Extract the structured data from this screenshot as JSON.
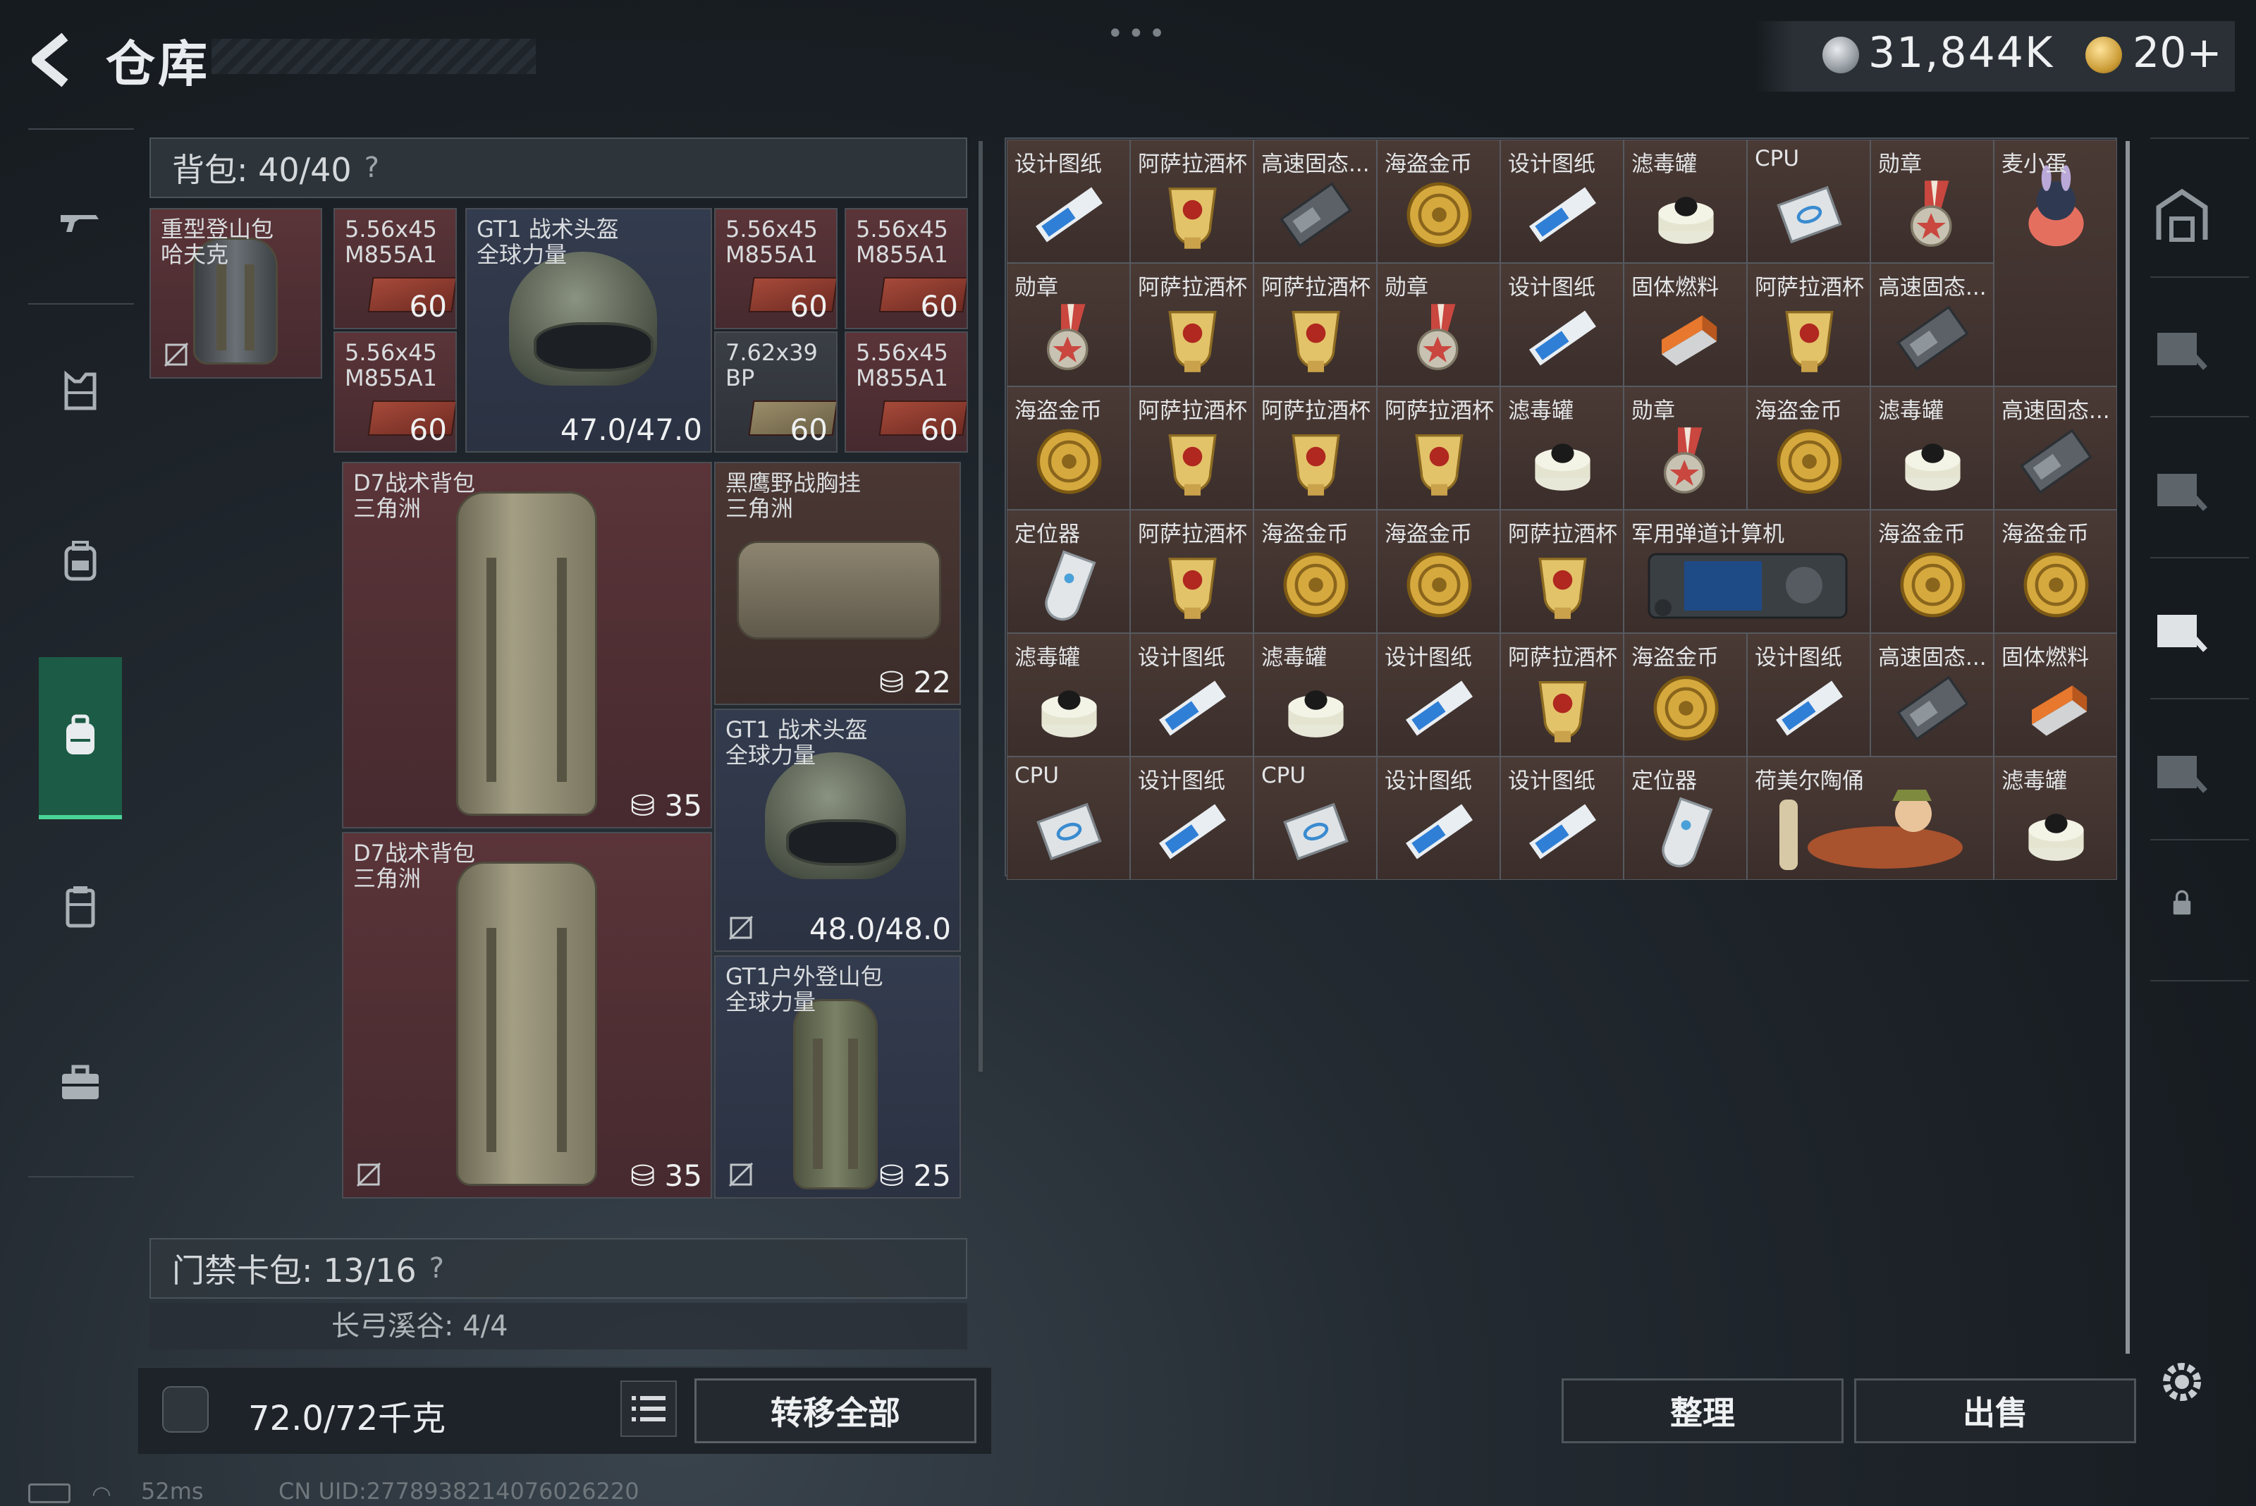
{
  "header": {
    "title": "仓库",
    "currency_value": "31,844K",
    "tickets_value": "20+"
  },
  "backpack": {
    "header_label": "背包: 40/40",
    "help": "?",
    "slots": {
      "hiking_pack": {
        "name": "重型登山包\n哈夫克"
      },
      "ammo1": {
        "name": "5.56x45\nM855A1",
        "qty": "60"
      },
      "ammo2": {
        "name": "5.56x45\nM855A1",
        "qty": "60"
      },
      "ammo3": {
        "name": "5.56x45\nM855A1",
        "qty": "60"
      },
      "ammo4": {
        "name": "5.56x45\nM855A1",
        "qty": "60"
      },
      "ammo5": {
        "name": "7.62x39\nBP",
        "qty": "60"
      },
      "ammo6": {
        "name": "5.56x45\nM855A1",
        "qty": "60"
      },
      "helmet1": {
        "name": "GT1 战术头盔\n全球力量",
        "durability": "47.0/47.0"
      },
      "d7_pack1": {
        "name": "D7战术背包\n三角洲",
        "capacity": "35"
      },
      "d7_pack2": {
        "name": "D7战术背包\n三角洲",
        "capacity": "35"
      },
      "chest_rig": {
        "name": "黑鹰野战胸挂\n三角洲",
        "capacity": "22"
      },
      "helmet2": {
        "name": "GT1 战术头盔\n全球力量",
        "durability": "48.0/48.0"
      },
      "outdoor_pack": {
        "name": "GT1户外登山包\n全球力量",
        "capacity": "25"
      }
    }
  },
  "keycard": {
    "header_label": "门禁卡包: 13/16",
    "help": "?",
    "sub_label": "长弓溪谷: 4/4"
  },
  "bottom": {
    "weight": "72.0/72千克",
    "transfer_all": "转移全部"
  },
  "status": {
    "ping": "52ms",
    "uid": "CN UID:2778938214076026220"
  },
  "warehouse": {
    "sort_label": "整理",
    "sell_label": "出售",
    "rows": [
      [
        "设计图纸",
        "阿萨拉酒杯",
        "高速固态...",
        "海盗金币",
        "设计图纸",
        "滤毒罐",
        "CPU",
        "勋章",
        "麦小蛋"
      ],
      [
        "勋章",
        "阿萨拉酒杯",
        "阿萨拉酒杯",
        "勋章",
        "设计图纸",
        "固体燃料",
        "阿萨拉酒杯",
        "高速固态..."
      ],
      [
        "海盗金币",
        "阿萨拉酒杯",
        "阿萨拉酒杯",
        "阿萨拉酒杯",
        "滤毒罐",
        "勋章",
        "海盗金币",
        "滤毒罐",
        "高速固态..."
      ],
      [
        "定位器",
        "阿萨拉酒杯",
        "海盗金币",
        "海盗金币",
        "阿萨拉酒杯",
        "军用弹道计算机",
        "海盗金币",
        "海盗金币"
      ],
      [
        "滤毒罐",
        "设计图纸",
        "滤毒罐",
        "设计图纸",
        "阿萨拉酒杯",
        "海盗金币",
        "设计图纸",
        "高速固态...",
        "固体燃料"
      ],
      [
        "CPU",
        "设计图纸",
        "CPU",
        "设计图纸",
        "设计图纸",
        "定位器",
        "荷美尔陶俑",
        "滤毒罐"
      ]
    ]
  },
  "colors": {
    "accent": "#49d397",
    "slot_red": "#5a3438",
    "slot_blue": "#333b4e",
    "cell_brown": "#4a3a35"
  }
}
